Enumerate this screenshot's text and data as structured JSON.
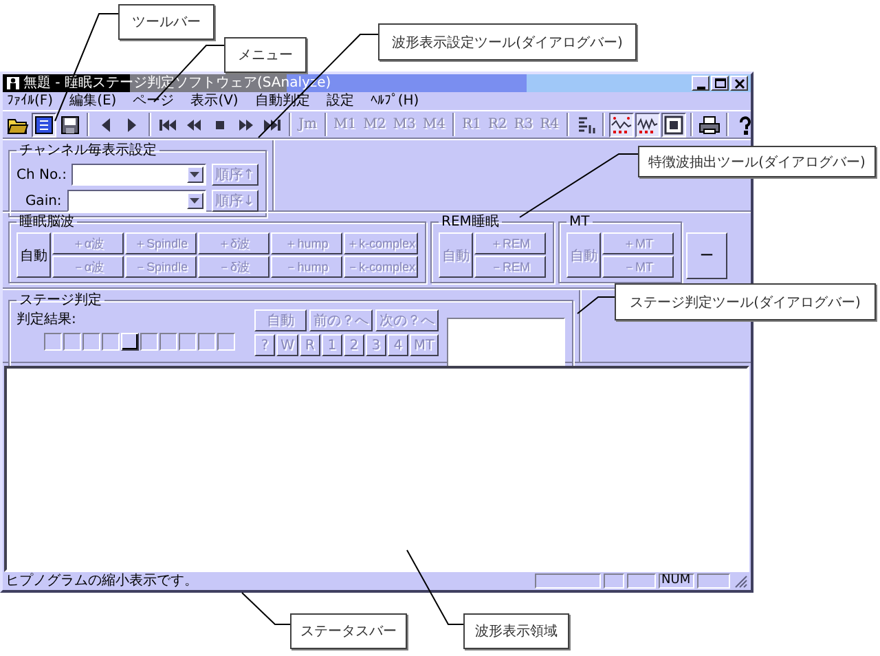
{
  "annotations": [
    {
      "text": "ツールバー"
    },
    {
      "text": "メニュー"
    },
    {
      "text": "波形表示設定ツール(ダイアログバー)"
    },
    {
      "text": "特徴波抽出ツール(ダイアログバー)"
    },
    {
      "text": "ステージ判定ツール(ダイアログバー)"
    },
    {
      "text": "ステータスバー"
    },
    {
      "text": "波形表示領域"
    }
  ],
  "window": {
    "title": "無題 - 睡眠ステージ判定ソフトウェア(SAnalyze)"
  },
  "menu": [
    {
      "label": "ﾌｧｲﾙ(F)"
    },
    {
      "label": "編集(E)"
    },
    {
      "label": "ページ"
    },
    {
      "label": "表示(V)"
    },
    {
      "label": "自動判定"
    },
    {
      "label": "設定"
    },
    {
      "label": "ﾍﾙﾌﾟ(H)"
    }
  ],
  "toolbar": [
    {
      "kind": "open",
      "pressed": false
    },
    {
      "kind": "view",
      "pressed": true
    },
    {
      "kind": "save",
      "pressed": false
    },
    {
      "kind": "sep"
    },
    {
      "kind": "prev",
      "pressed": false
    },
    {
      "kind": "next",
      "pressed": false
    },
    {
      "kind": "sep"
    },
    {
      "kind": "first",
      "pressed": false
    },
    {
      "kind": "rewind",
      "pressed": false
    },
    {
      "kind": "stop",
      "pressed": false
    },
    {
      "kind": "forward",
      "pressed": false
    },
    {
      "kind": "last",
      "pressed": false
    },
    {
      "kind": "sep"
    },
    {
      "kind": "text",
      "label": "Jm",
      "disabled": true
    },
    {
      "kind": "sep"
    },
    {
      "kind": "text",
      "label": "M1",
      "disabled": true
    },
    {
      "kind": "text",
      "label": "M2",
      "disabled": true
    },
    {
      "kind": "text",
      "label": "M3",
      "disabled": true
    },
    {
      "kind": "text",
      "label": "M4",
      "disabled": true
    },
    {
      "kind": "sep"
    },
    {
      "kind": "text",
      "label": "R1",
      "disabled": true
    },
    {
      "kind": "text",
      "label": "R2",
      "disabled": true
    },
    {
      "kind": "text",
      "label": "R3",
      "disabled": true
    },
    {
      "kind": "text",
      "label": "R4",
      "disabled": true
    },
    {
      "kind": "sep"
    },
    {
      "kind": "bars",
      "pressed": false
    },
    {
      "kind": "sep"
    },
    {
      "kind": "wave",
      "pressed": true
    },
    {
      "kind": "wave2",
      "pressed": true
    },
    {
      "kind": "frame",
      "pressed": true
    },
    {
      "kind": "sep"
    },
    {
      "kind": "print",
      "pressed": false
    },
    {
      "kind": "sep"
    },
    {
      "kind": "help",
      "pressed": false
    }
  ],
  "channel_settings": {
    "title": "チャンネル毎表示設定",
    "rows": [
      {
        "label": "Ch No.:",
        "button": "順序↑",
        "disabled": true
      },
      {
        "label": "Gain:",
        "button": "順序↓",
        "disabled": true
      }
    ]
  },
  "feature_groups": [
    {
      "title": "睡眠脳波",
      "auto": {
        "label": "自動",
        "disabled": false
      },
      "plus": [
        {
          "label": "＋α波",
          "disabled": true
        },
        {
          "label": "＋Spindle",
          "disabled": true
        },
        {
          "label": "＋δ波",
          "disabled": true
        },
        {
          "label": "＋hump",
          "disabled": true
        },
        {
          "label": "＋k-complex",
          "disabled": true
        }
      ],
      "minus": [
        {
          "label": "－α波",
          "disabled": true
        },
        {
          "label": "－Spindle",
          "disabled": true
        },
        {
          "label": "－δ波",
          "disabled": true
        },
        {
          "label": "－hump",
          "disabled": true
        },
        {
          "label": "－k-complex",
          "disabled": true
        }
      ]
    },
    {
      "title": "REM睡眠",
      "auto": {
        "label": "自動",
        "disabled": true
      },
      "plus": [
        {
          "label": "＋REM",
          "disabled": true
        }
      ],
      "minus": [
        {
          "label": "－REM",
          "disabled": true
        }
      ]
    },
    {
      "title": "MT",
      "auto": {
        "label": "自動",
        "disabled": true
      },
      "plus": [
        {
          "label": "＋MT",
          "disabled": true
        }
      ],
      "minus": [
        {
          "label": "－MT",
          "disabled": true
        }
      ]
    }
  ],
  "extra_button": {
    "label": "ー"
  },
  "stage": {
    "title": "ステージ判定",
    "result_label": "判定結果:",
    "boxes": [
      {
        "selected": false
      },
      {
        "selected": false
      },
      {
        "selected": false
      },
      {
        "selected": false
      },
      {
        "selected": true
      },
      {
        "selected": false
      },
      {
        "selected": false
      },
      {
        "selected": false
      },
      {
        "selected": false
      },
      {
        "selected": false
      }
    ],
    "nav_buttons": [
      {
        "label": "自動",
        "disabled": true
      },
      {
        "label": "前の？へ",
        "disabled": true
      },
      {
        "label": "次の？へ",
        "disabled": true
      }
    ],
    "stage_buttons": [
      {
        "label": "?",
        "disabled": true
      },
      {
        "label": "W",
        "disabled": true
      },
      {
        "label": "R",
        "disabled": true
      },
      {
        "label": "1",
        "disabled": true
      },
      {
        "label": "2",
        "disabled": true
      },
      {
        "label": "3",
        "disabled": true
      },
      {
        "label": "4",
        "disabled": true
      },
      {
        "label": "MT",
        "disabled": true
      }
    ]
  },
  "status_bar": {
    "message": "ヒプノグラムの縮小表示です。",
    "panes": [
      {
        "kind": "blank"
      },
      {
        "kind": "blank"
      },
      {
        "kind": "blank"
      },
      {
        "kind": "text",
        "text": "NUM"
      },
      {
        "kind": "blank"
      }
    ]
  }
}
